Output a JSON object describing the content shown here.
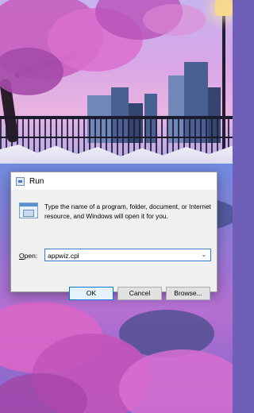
{
  "dialog": {
    "title": "Run",
    "icon": "run-icon",
    "description": "Type the name of a program, folder, document, or Internet resource, and Windows will open it for you.",
    "open_label": "pen:",
    "open_label_accel": "O",
    "open_value": "appwiz.cpl",
    "buttons": {
      "ok": "OK",
      "cancel": "Cancel",
      "browse": "Browse..."
    }
  },
  "colors": {
    "accent": "#0078d7",
    "dialog_bg": "#f0f0f0"
  }
}
